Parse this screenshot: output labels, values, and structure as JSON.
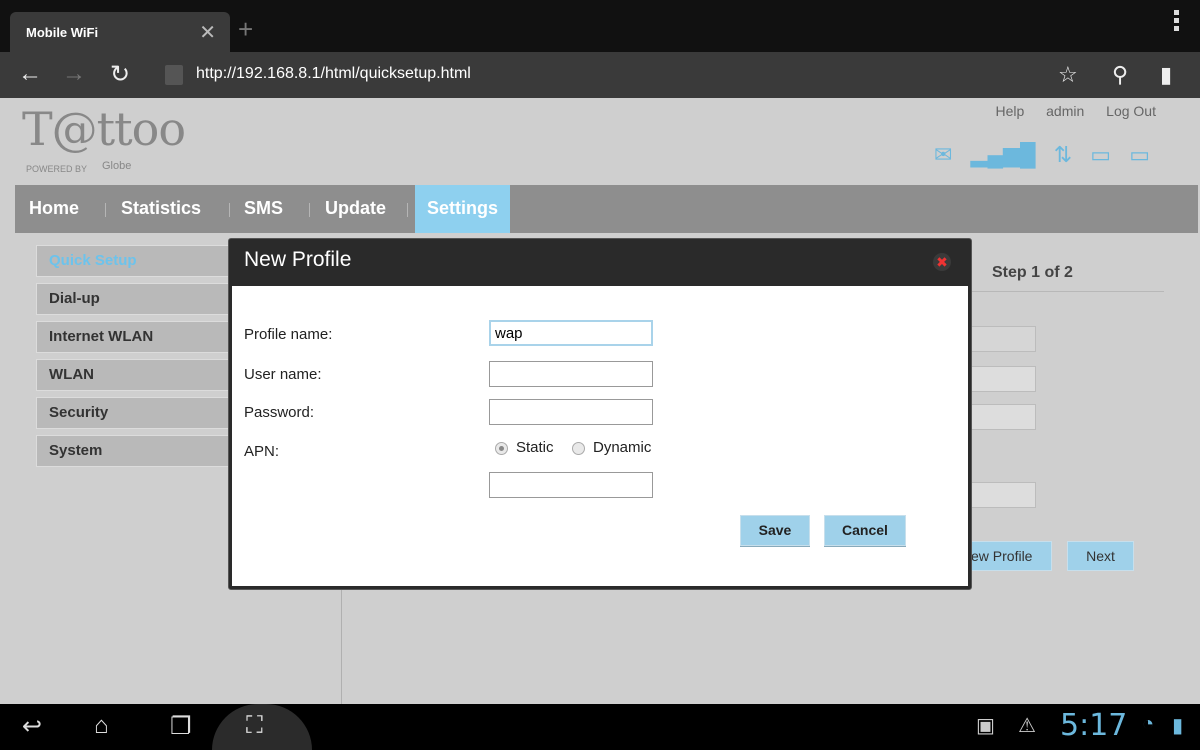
{
  "browser": {
    "tab_title": "Mobile WiFi",
    "tab_close": "✕",
    "new_tab": "+",
    "url": "http://192.168.8.1/html/quicksetup.html",
    "back": "←",
    "forward": "→",
    "reload": "↻",
    "star": "☆",
    "search": "⚲",
    "bookmark": "▮"
  },
  "header": {
    "logo_text": "T@ttoo",
    "logo_powered": "POWERED BY",
    "logo_globe": "Globe",
    "links": [
      "Help",
      "admin",
      "Log Out"
    ],
    "status_icons": [
      "mail-icon",
      "signal-icon",
      "data-transfer-icon",
      "wifi-device-icon",
      "battery-icon"
    ]
  },
  "menu": {
    "items": [
      "Home",
      "Statistics",
      "SMS",
      "Update",
      "Settings"
    ],
    "active": "Settings"
  },
  "sidebar": {
    "items": [
      "Quick Setup",
      "Dial-up",
      "Internet WLAN",
      "WLAN",
      "Security",
      "System"
    ],
    "active": "Quick Setup"
  },
  "wizard": {
    "step": "Step 1 of 2",
    "new_profile_btn": "ew Profile",
    "next_btn": "Next"
  },
  "modal": {
    "title": "New Profile",
    "close": "✖",
    "profile_name_label": "Profile name:",
    "profile_name_value": "wap",
    "user_name_label": "User name:",
    "user_name_value": "",
    "password_label": "Password:",
    "password_value": "",
    "apn_label": "APN:",
    "apn_static": "Static",
    "apn_dynamic": "Dynamic",
    "apn_value": "",
    "save": "Save",
    "cancel": "Cancel"
  },
  "system": {
    "clock": "5:17"
  },
  "colors": {
    "accent": "#8ed0ef",
    "menu_bg": "#8e8e8e",
    "page_bg": "#cfcfcf"
  }
}
